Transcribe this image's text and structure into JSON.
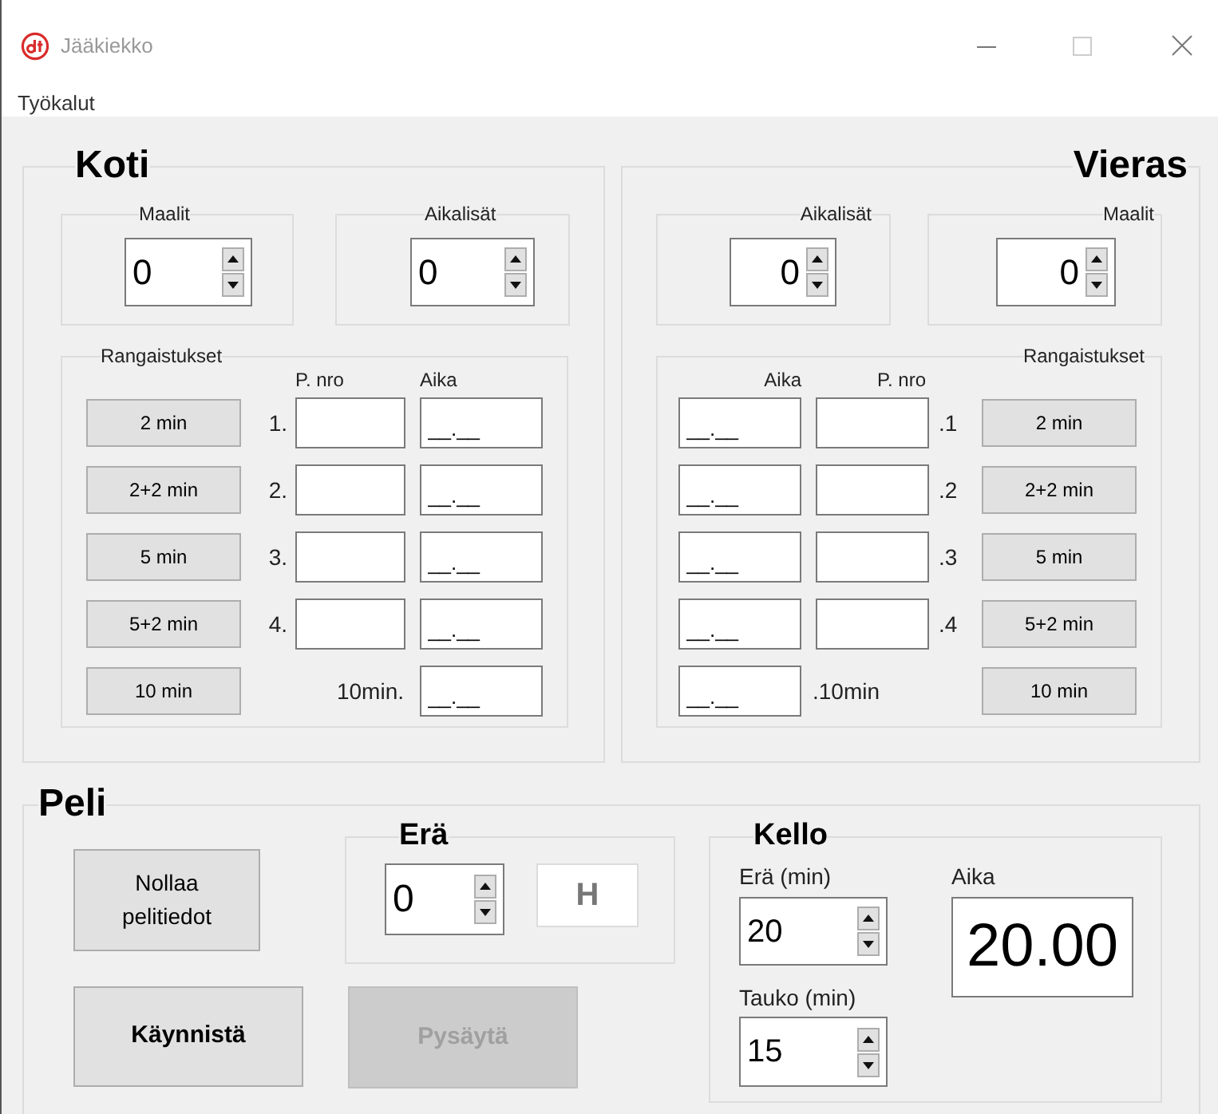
{
  "window": {
    "title": "Jääkiekko"
  },
  "menu": [
    "Työkalut"
  ],
  "home": {
    "title": "Koti",
    "goals": {
      "label": "Maalit",
      "value": "0"
    },
    "timeouts": {
      "label": "Aikalisät",
      "value": "0"
    },
    "penalties": {
      "title": "Rangaistukset",
      "player_header": "P. nro",
      "time_header": "Aika",
      "buttons": [
        "2 min",
        "2+2 min",
        "5 min",
        "5+2 min",
        "10 min"
      ],
      "rows": [
        {
          "label": "1.",
          "time": "__.__"
        },
        {
          "label": "2.",
          "time": "__.__"
        },
        {
          "label": "3.",
          "time": "__.__"
        },
        {
          "label": "4.",
          "time": "__.__"
        }
      ],
      "ten_min": {
        "label": "10min.",
        "time": "__.__"
      }
    }
  },
  "away": {
    "title": "Vieras",
    "timeouts": {
      "label": "Aikalisät",
      "value": "0"
    },
    "goals": {
      "label": "Maalit",
      "value": "0"
    },
    "penalties": {
      "title": "Rangaistukset",
      "time_header": "Aika",
      "player_header": "P. nro",
      "buttons": [
        "2 min",
        "2+2 min",
        "5 min",
        "5+2 min",
        "10 min"
      ],
      "rows": [
        {
          "label": ".1",
          "time": "__.__"
        },
        {
          "label": ".2",
          "time": "__.__"
        },
        {
          "label": ".3",
          "time": "__.__"
        },
        {
          "label": ".4",
          "time": "__.__"
        }
      ],
      "ten_min": {
        "label": ".10min",
        "time": "__.__"
      }
    }
  },
  "game": {
    "title": "Peli",
    "reset_button": {
      "label": "Nollaa pelitiedot"
    },
    "period": {
      "title": "Erä",
      "value": "0",
      "indicator": "H"
    },
    "start_button": {
      "label": "Käynnistä",
      "disabled": false
    },
    "stop_button": {
      "label": "Pysäytä",
      "disabled": true
    },
    "clock": {
      "title": "Kello",
      "period_label": "Erä (min)",
      "period_value": "20",
      "break_label": "Tauko (min)",
      "break_value": "15",
      "time_label": "Aika",
      "time": "20.00"
    }
  }
}
